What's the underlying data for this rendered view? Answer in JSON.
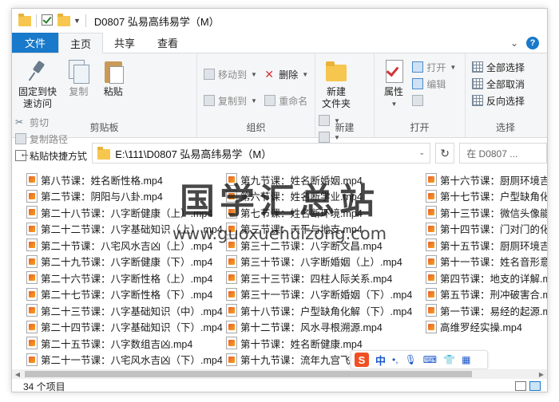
{
  "window": {
    "title": "D0807 弘易高纬易学（M）"
  },
  "tabs": [
    {
      "label": "文件"
    },
    {
      "label": "主页"
    },
    {
      "label": "共享"
    },
    {
      "label": "查看"
    }
  ],
  "ribbon": {
    "clipboard": {
      "label": "剪贴板",
      "pin_line1": "固定到快",
      "pin_line2": "速访问",
      "copy": "复制",
      "paste": "粘贴",
      "cut": "剪切",
      "copy_path": "复制路径",
      "paste_shortcut": "粘贴快捷方式"
    },
    "organize": {
      "label": "组织",
      "move_to": "移动到",
      "copy_to": "复制到",
      "delete": "删除",
      "rename": "重命名"
    },
    "new": {
      "label": "新建",
      "new_folder_line1": "新建",
      "new_folder_line2": "文件夹"
    },
    "open": {
      "label": "打开",
      "properties": "属性",
      "open": "打开",
      "edit": "编辑"
    },
    "select": {
      "label": "选择",
      "select_all": "全部选择",
      "select_none": "全部取消",
      "invert": "反向选择"
    }
  },
  "address": {
    "path": "E:\\111\\D0807 弘易高纬易学（M）",
    "search_placeholder": "在 D0807 ..."
  },
  "files": {
    "col1": [
      "第八节课：姓名断性格.mp4",
      "第二节课：阴阳与八卦.mp4",
      "第二十八节课：八字断健康（上）.mp4",
      "第二十二节课：八字基础知识（上）.mp4",
      "第二十节课：八宅风水吉凶（上）.mp4",
      "第二十九节课：八字断健康（下）.mp4",
      "第二十六节课：八字断性格（上）.mp4",
      "第二十七节课：八字断性格（下）.mp4",
      "第二十三节课：八字基础知识（中）.mp4",
      "第二十四节课：八字基础知识（下）.mp4",
      "第二十五节课：八字数组吉凶.mp4",
      "第二十一节课：八宅风水吉凶（下）.mp4"
    ],
    "col2": [
      "第九节课：姓名断婚姻.mp4",
      "第六节课：姓名断学业.mp4",
      "第七节课：姓名断环境.mp4",
      "第三节课：天干与地支.mp4",
      "第三十二节课：八字断文昌.mp4",
      "第三十节课：八字断婚姻（上）.mp4",
      "第三十三节课：四柱人际关系.mp4",
      "第三十一节课：八字断婚姻（下）.mp4",
      "第十八节课：户型缺角化解（下）.mp4",
      "第十二节课：风水寻根溯源.mp4",
      "第十节课：姓名断健康.mp4",
      "第十九节课：流年九宫飞星.mp4"
    ],
    "col3": [
      "第十六节课：厨厕环境吉凶",
      "第十七节课：户型缺角化解",
      "第十三节课：微信头像能量",
      "第十四节课：门对门的化解",
      "第十五节课：厨厕环境吉凶",
      "第十一节课：姓名音形意.m",
      "第四节课：地支的详解.mp4",
      "第五节课：刑冲破害合.mp4",
      "第一节课：易经的起源.mp4",
      "高维罗经实操.mp4"
    ]
  },
  "watermark": {
    "title": "国学汇总站",
    "url": "www.guoxuehuizong.com"
  },
  "ime": {
    "logo": "S",
    "mode": "中"
  },
  "status": {
    "count": "34 个项目"
  }
}
